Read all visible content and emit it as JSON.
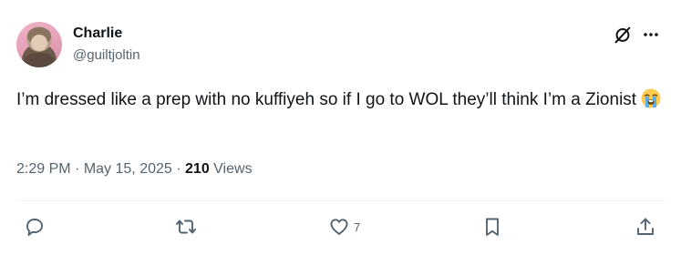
{
  "author": {
    "display_name": "Charlie",
    "handle": "@guiltjoltin"
  },
  "tweet": {
    "text": "I’m dressed like a prep with no kuffiyeh so if I go to WOL they’ll think I’m a Zionist",
    "emoji": "loudly-crying-face"
  },
  "meta": {
    "time": "2:29 PM",
    "separator": "·",
    "date": "May 15, 2025",
    "views_count": "210",
    "views_label": "Views"
  },
  "actions": {
    "reply_icon": "reply-icon",
    "retweet_icon": "retweet-icon",
    "like_icon": "heart-icon",
    "like_count": "7",
    "bookmark_icon": "bookmark-icon",
    "share_icon": "share-icon"
  },
  "header_icons": [
    "grok-icon",
    "more-icon"
  ],
  "colors": {
    "text": "#0f1419",
    "secondary": "#536471",
    "divider": "#eff3f4"
  }
}
